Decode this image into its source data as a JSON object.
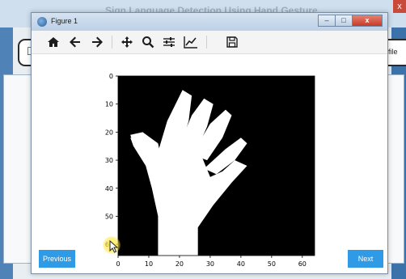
{
  "background_app": {
    "title": "Sign Language Detection Using Hand Gesture",
    "right_button_label": "file",
    "close_label": "x"
  },
  "window": {
    "title": "Figure 1",
    "minimize_label": "–",
    "maximize_label": "□",
    "close_label": "x"
  },
  "toolbar": {
    "items": [
      {
        "icon": "home-icon",
        "glyph": "⌂"
      },
      {
        "icon": "back-arrow-icon",
        "glyph": "←"
      },
      {
        "icon": "forward-arrow-icon",
        "glyph": "→"
      },
      {
        "icon": "pan-icon",
        "glyph": "✛"
      },
      {
        "icon": "zoom-icon",
        "glyph": "⌕"
      },
      {
        "icon": "configure-subplots-icon",
        "glyph": "☷"
      },
      {
        "icon": "edit-axis-icon",
        "glyph": "↗"
      },
      {
        "icon": "save-icon",
        "glyph": "▣"
      }
    ]
  },
  "chart_data": {
    "type": "heatmap",
    "colormap": "gray",
    "x_ticks": [
      "0",
      "10",
      "20",
      "30",
      "40",
      "50",
      "60"
    ],
    "y_ticks": [
      "0",
      "10",
      "20",
      "30",
      "40",
      "50",
      "60"
    ],
    "xlim": [
      0,
      64
    ],
    "ylim": [
      64,
      0
    ],
    "image_size": [
      64,
      64
    ],
    "content": "binary hand silhouette (white) on black background"
  },
  "navigation": {
    "previous_label": "Previous",
    "next_label": "Next"
  }
}
